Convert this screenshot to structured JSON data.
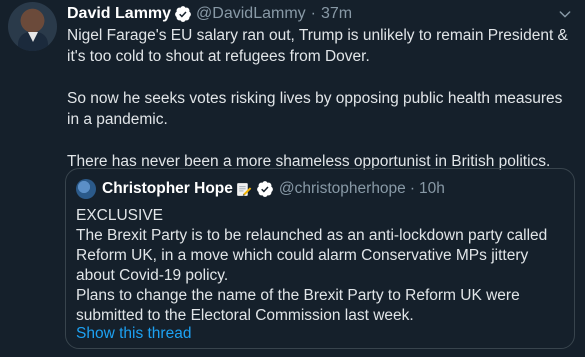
{
  "tweet": {
    "author_name": "David Lammy",
    "author_handle": "@DavidLammy",
    "separator": "·",
    "time": "37m",
    "paragraphs": [
      "Nigel Farage's EU salary ran out, Trump is unlikely to remain President & it's too cold to shout at refugees from Dover.",
      "So now he seeks votes risking lives by opposing public health measures in a pandemic.",
      "There has never been a more shameless opportunist in British politics."
    ]
  },
  "quoted_tweet": {
    "author_name": "Christopher Hope",
    "author_emoji": "memo-icon",
    "author_handle": "@christopherhope",
    "separator": "·",
    "time": "10h",
    "lines": [
      "EXCLUSIVE",
      "The Brexit Party is to be relaunched as an anti-lockdown party called Reform UK, in a move which could alarm Conservative MPs jittery about Covid-19 policy.",
      "Plans to change the name of the Brexit Party to Reform UK were submitted to the Electoral Commission last week."
    ],
    "show_thread": "Show this thread"
  },
  "colors": {
    "background": "#15202b",
    "text": "#e1e5e8",
    "muted": "#8899a6",
    "link": "#1da1f2",
    "border": "#38444d"
  }
}
